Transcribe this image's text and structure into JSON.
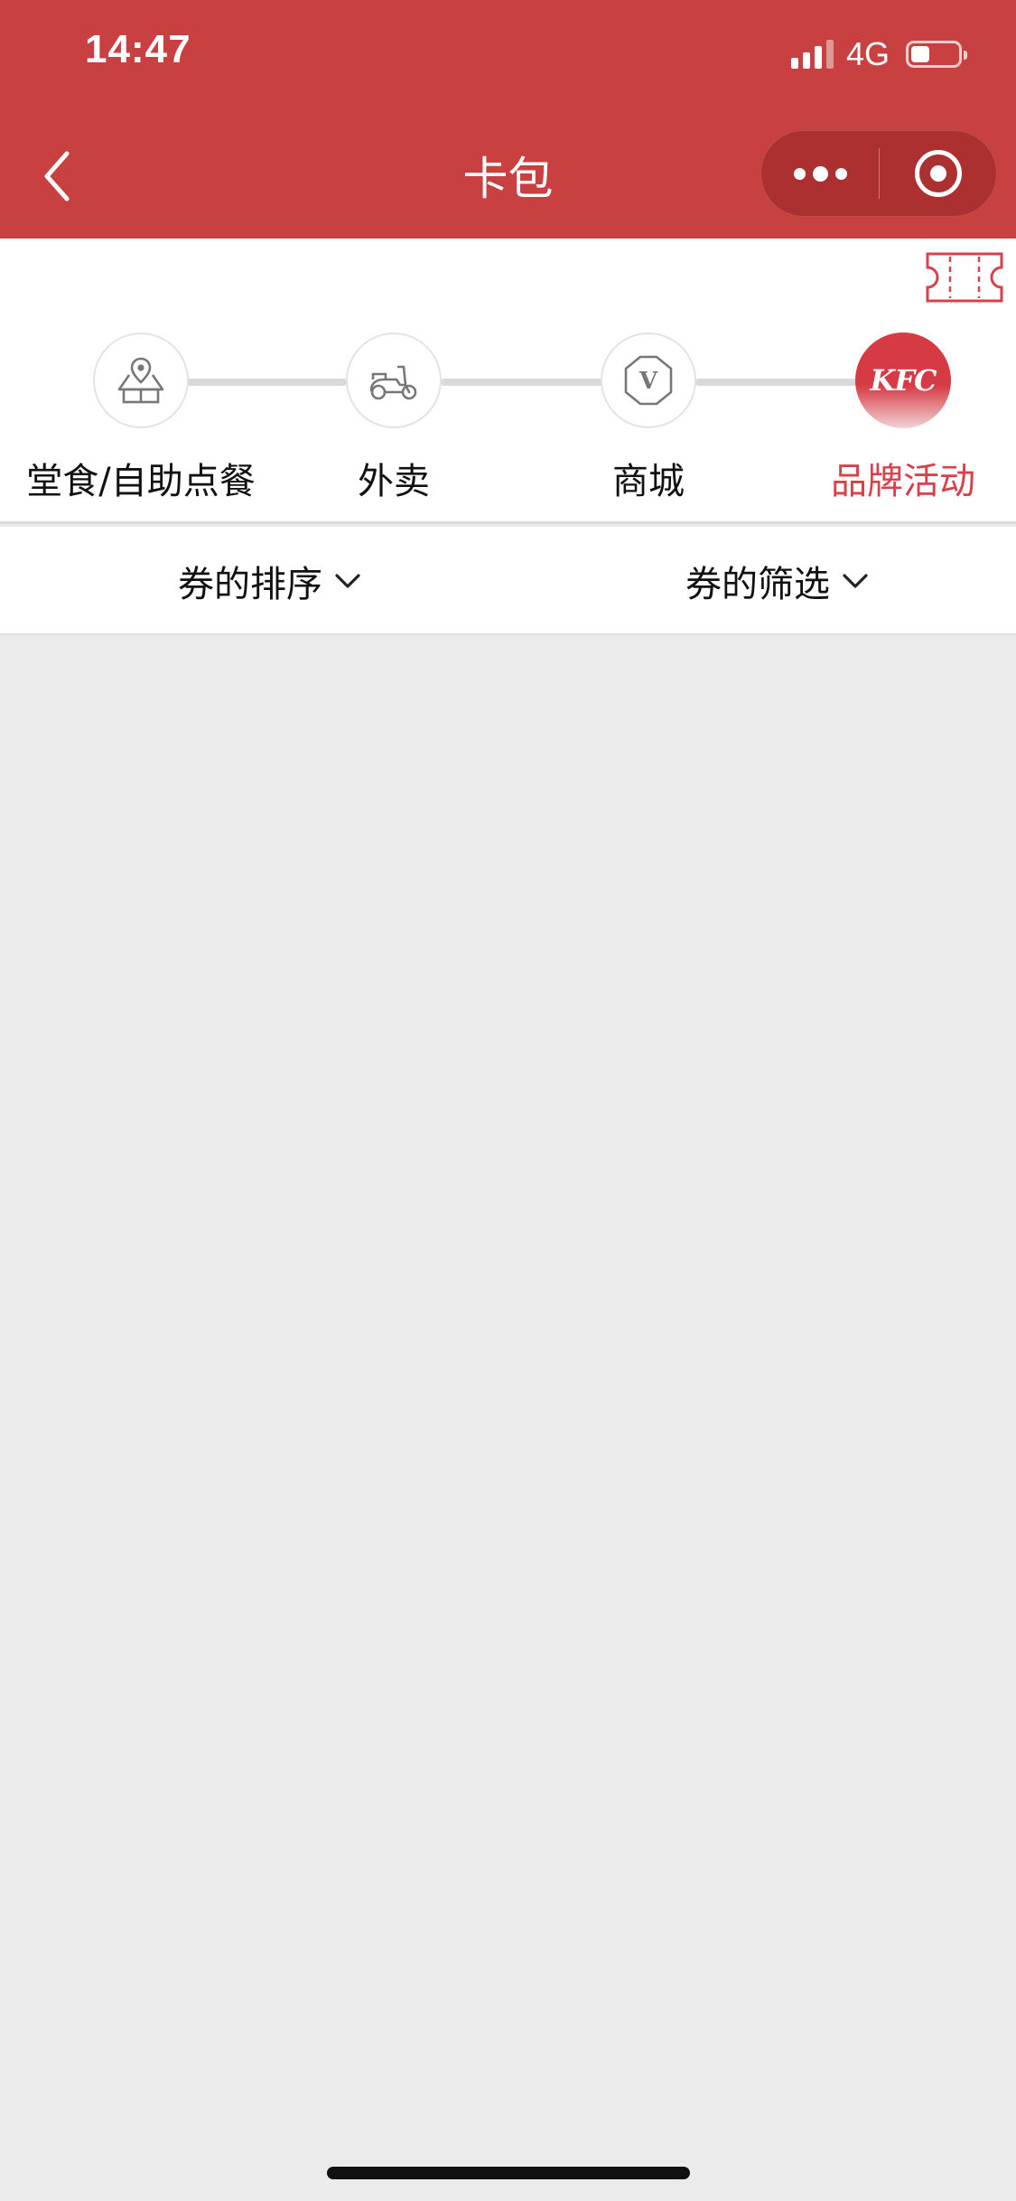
{
  "status_bar": {
    "time": "14:47",
    "network": "4G",
    "battery_percent": 40
  },
  "nav": {
    "title": "卡包"
  },
  "categories": [
    {
      "label": "堂食/自助点餐",
      "icon": "store-location-icon",
      "active": false
    },
    {
      "label": "外卖",
      "icon": "scooter-icon",
      "active": false
    },
    {
      "label": "商城",
      "icon": "v-badge-icon",
      "active": false
    },
    {
      "label": "品牌活动",
      "icon": "kfc-logo-icon",
      "logo_text": "KFC",
      "active": true
    }
  ],
  "filters": {
    "sort_label": "券的排序",
    "filter_label": "券的筛选"
  },
  "colors": {
    "brand_red": "#c84040",
    "active_red": "#d8414a",
    "background": "#ebebeb"
  }
}
